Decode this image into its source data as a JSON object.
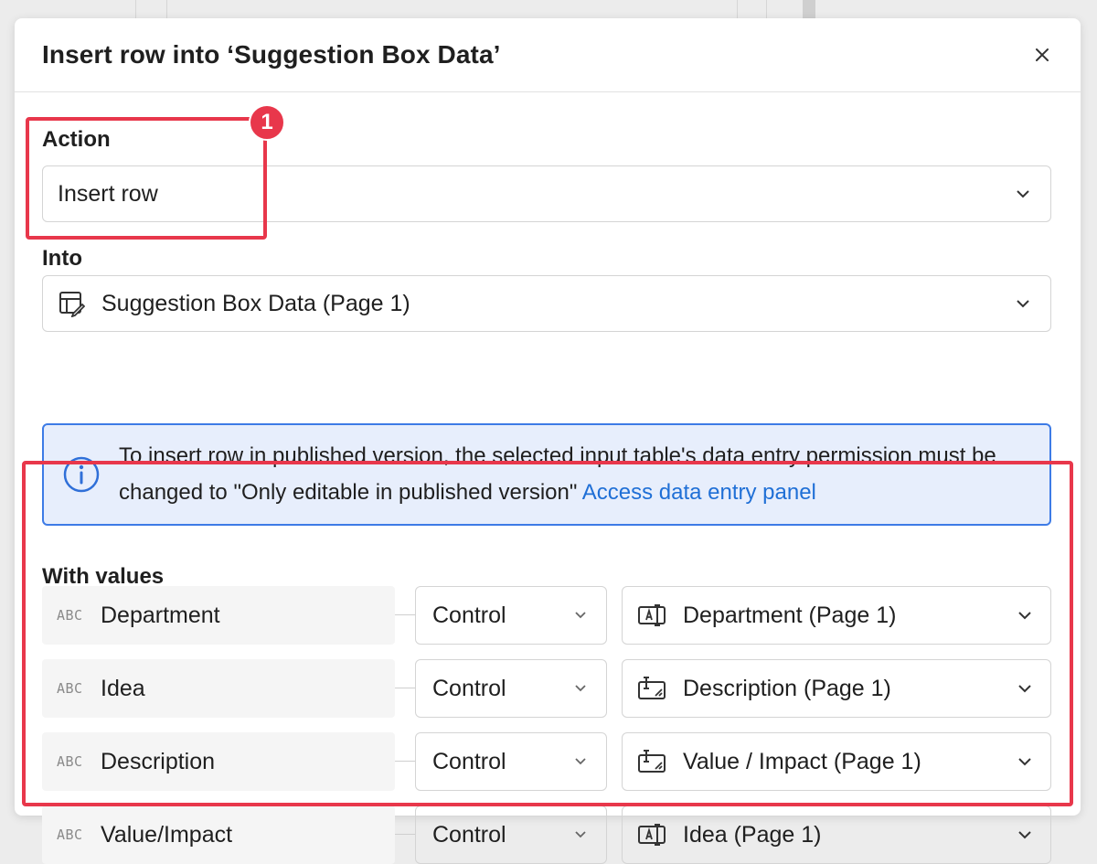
{
  "modal": {
    "title": "Insert row into ‘Suggestion Box Data’"
  },
  "action": {
    "label": "Action",
    "value": "Insert row"
  },
  "into": {
    "label": "Into",
    "value": "Suggestion Box Data (Page 1)"
  },
  "info": {
    "text": "To insert row in published version, the selected input table's data entry permission must be changed to \"Only editable in published version\"",
    "link": "Access data entry panel"
  },
  "with_values": {
    "label": "With values",
    "rows": [
      {
        "type": "ABC",
        "column": "Department",
        "source": "Control",
        "value": "Department (Page 1)",
        "icon": "text-input-icon"
      },
      {
        "type": "ABC",
        "column": "Idea",
        "source": "Control",
        "value": "Description (Page 1)",
        "icon": "text-area-icon"
      },
      {
        "type": "ABC",
        "column": "Description",
        "source": "Control",
        "value": "Value / Impact (Page 1)",
        "icon": "text-area-icon"
      },
      {
        "type": "ABC",
        "column": "Value/Impact",
        "source": "Control",
        "value": "Idea (Page 1)",
        "icon": "text-input-icon"
      }
    ]
  },
  "annotation": {
    "badge": "1",
    "color": "#e8374b"
  },
  "colors": {
    "info_bg": "#e7eefc",
    "info_border": "#3d7be6",
    "link": "#1f6fd6"
  }
}
